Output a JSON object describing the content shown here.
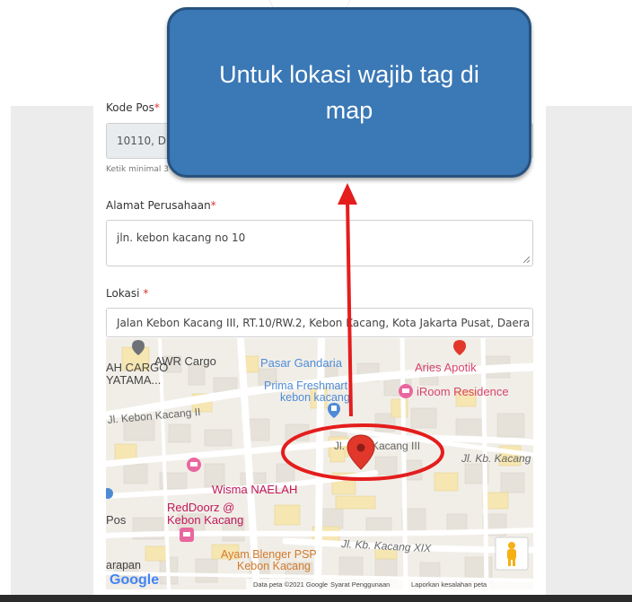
{
  "callout": {
    "text": "Untuk lokasi wajib tag di map"
  },
  "form": {
    "postal_code": {
      "label": "Kode Pos",
      "required_mark": "*",
      "value": "10110, D",
      "hint": "Ketik minimal 3"
    },
    "company_address": {
      "label": "Alamat Perusahaan",
      "required_mark": "*",
      "value": "jln. kebon kacang no 10"
    },
    "location": {
      "label": "Lokasi",
      "required_mark": " *",
      "value": "Jalan Kebon Kacang III, RT.10/RW.2, Kebon Kacang, Kota Jakarta Pusat, Daera"
    }
  },
  "map": {
    "places": [
      {
        "name": "AWR Cargo"
      },
      {
        "name": "Pasar Gandaria"
      },
      {
        "name": "Aries Apotik"
      },
      {
        "name": "AH CARGO"
      },
      {
        "name": "YATAMA..."
      },
      {
        "name": "Prima Freshmart"
      },
      {
        "name": "kebon kacang"
      },
      {
        "name": "iRoom Residence"
      },
      {
        "name": "Wisma NAELAH"
      },
      {
        "name": "RedDoorz @"
      },
      {
        "name": "Kebon Kacang"
      },
      {
        "name": "Ayam Blenger PSP"
      },
      {
        "name": "Kebon Kacang"
      },
      {
        "name": "Pos"
      },
      {
        "name": "arapan"
      }
    ],
    "streets": [
      {
        "name": "Jl. Kebon Kacang II"
      },
      {
        "name": "Jl."
      },
      {
        "name": "Kacang III"
      },
      {
        "name": "Jl. Kb. Kacang"
      },
      {
        "name": "Jl. Kb. Kacang XIX"
      }
    ],
    "attribution": {
      "logo": "Google",
      "data": "Data peta ©2021 Google",
      "terms": "Syarat Penggunaan",
      "report": "Laporkan kesalahan peta"
    },
    "icons": {
      "pin": "map-pin-icon",
      "pegman": "street-view-pegman-icon"
    },
    "colors": {
      "pin": "#e2372b",
      "highlight_ring": "#e41d1d",
      "arrow": "#e41d1d",
      "callout": "#3a78b6",
      "poi_pink": "#e9679e",
      "poi_blue": "#4e8bd6"
    }
  }
}
